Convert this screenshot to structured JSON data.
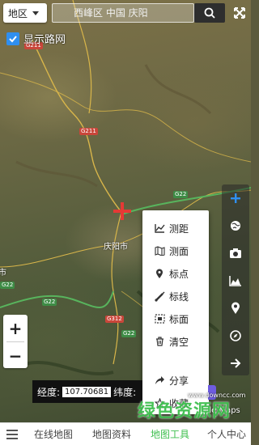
{
  "topbar": {
    "region_label": "地区",
    "search_placeholder": "西峰区 中国 庆阳",
    "search_icon": "search-icon",
    "expand_icon": "expand-icon"
  },
  "road_net": {
    "label": "显示路网",
    "checked": true
  },
  "map": {
    "city": "庆阳市",
    "city_fragment": "市",
    "road_labels": [
      "G211",
      "G211",
      "G22",
      "G22",
      "G22",
      "G312",
      "G22"
    ],
    "attribution": "gle Maps",
    "crosshair_color": "#e53935"
  },
  "tools": [
    "plus-icon",
    "globe-icon",
    "camera-icon",
    "elevation-icon",
    "location-pin-icon",
    "compass-icon",
    "arrow-right-icon"
  ],
  "zoom": {
    "in": "+",
    "out": "−"
  },
  "popup": {
    "items": [
      {
        "label": "测距",
        "icon": "measure-distance-icon"
      },
      {
        "label": "测面",
        "icon": "measure-area-icon"
      },
      {
        "label": "标点",
        "icon": "mark-point-icon"
      },
      {
        "label": "标线",
        "icon": "mark-line-icon"
      },
      {
        "label": "标面",
        "icon": "mark-area-icon"
      },
      {
        "label": "清空",
        "icon": "trash-icon"
      },
      {
        "label": "分享",
        "icon": "share-icon"
      },
      {
        "label": "收藏",
        "icon": "star-icon"
      }
    ]
  },
  "coords": {
    "lon_label": "经度:",
    "lon_value": "107.70681",
    "lat_label": "纬度:"
  },
  "watermark": {
    "text": "绿色资源网",
    "url": "www.downcc.com"
  },
  "nav": {
    "tabs": [
      "在线地图",
      "地图资料",
      "地图工具",
      "个人中心"
    ],
    "active_index": 2,
    "accent": "#3fbf4f"
  }
}
